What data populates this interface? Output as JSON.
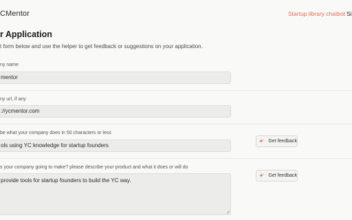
{
  "header": {
    "logo_text": "CMentor",
    "nav_chatbot": "Startup library chatbot",
    "nav_cut": "Si"
  },
  "page": {
    "title": "r Application",
    "subtitle": "t form below and use the helper to get feedback or suggestions on your application."
  },
  "fields": [
    {
      "label": "ny name",
      "value": "mentor"
    },
    {
      "label": "ny url, if any",
      "value": "://ycmentor.com"
    },
    {
      "label": "be what your company does in 50 characters or less",
      "value": "ols using YC knowledge for startup founders"
    },
    {
      "label": "s your company going to make? please describe your product and what it does or will do",
      "value": "provide tools for startup founders to build the YC way."
    }
  ],
  "feedback_button_label": "Get feedback",
  "colors": {
    "accent": "#e8694a",
    "background": "#f9f9f8",
    "input_bg": "#ececea"
  },
  "icons": {
    "feedback": "sparkle-icon"
  }
}
